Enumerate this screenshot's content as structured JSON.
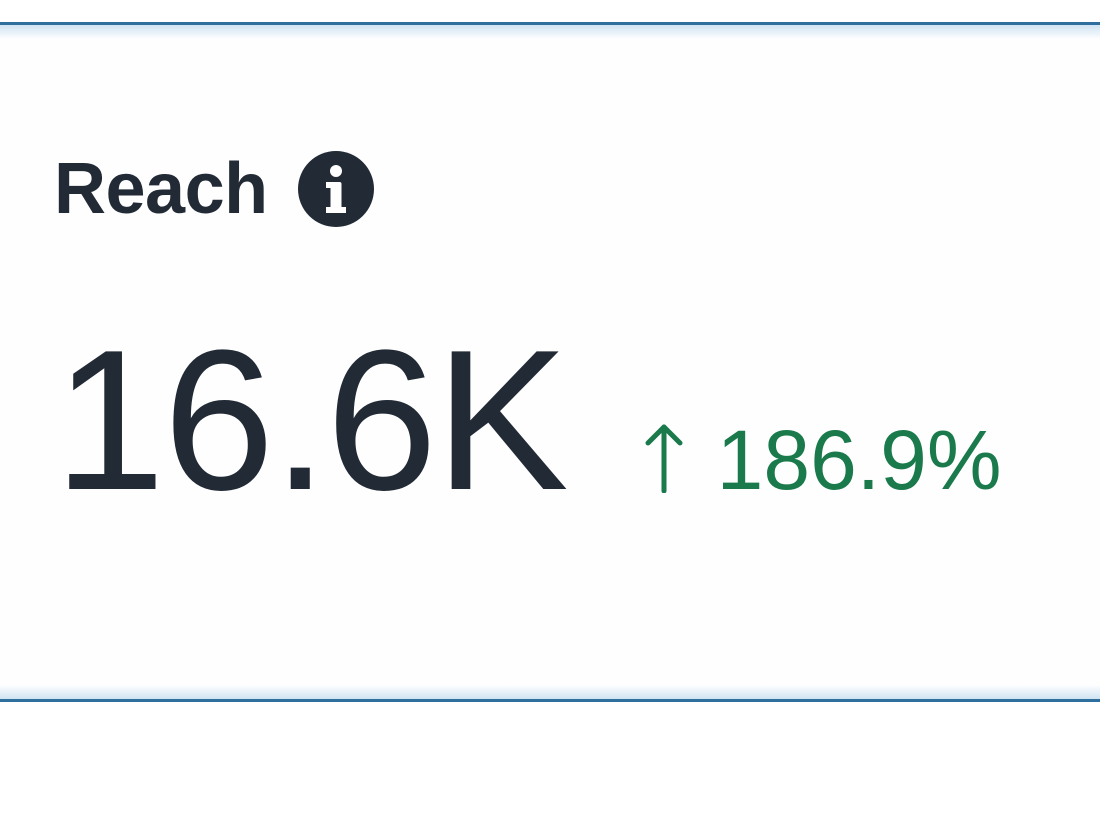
{
  "metric_card": {
    "title": "Reach",
    "value": "16.6K",
    "change": {
      "direction": "up",
      "arrow": "↑",
      "value": "186.9%"
    },
    "info_icon": "info-icon"
  },
  "colors": {
    "text_primary": "#222b35",
    "positive": "#1a7a4c",
    "border_accent": "#2e6f9e"
  }
}
